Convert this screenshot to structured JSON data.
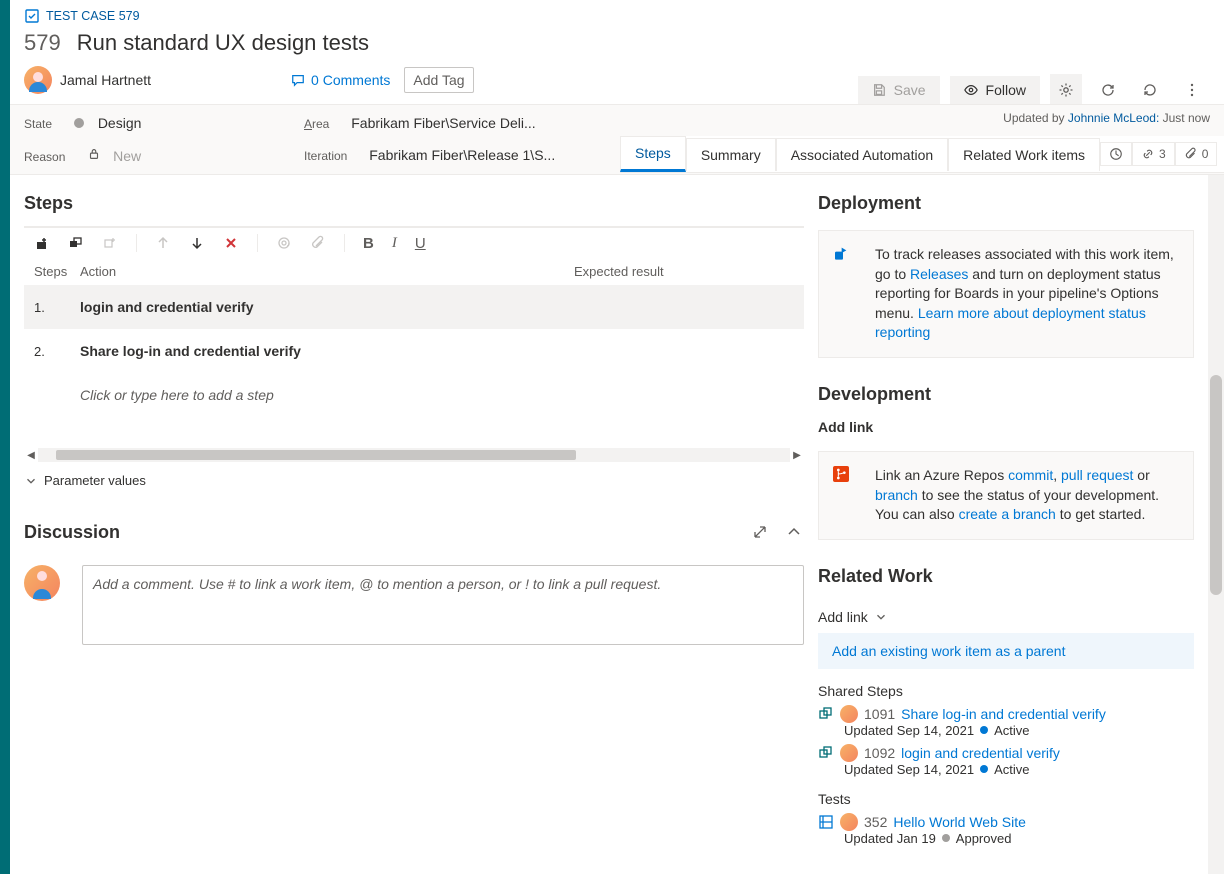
{
  "workItemType": "TEST CASE 579",
  "id": "579",
  "title": "Run standard UX design tests",
  "owner": "Jamal Hartnett",
  "comments": {
    "count": "0 Comments"
  },
  "addTag": "Add Tag",
  "actions": {
    "save": "Save",
    "follow": "Follow"
  },
  "updatedBy": {
    "prefix": "Updated by ",
    "name": "Johnnie McLeod:",
    "when": " Just now"
  },
  "fields": {
    "stateLabel": "State",
    "stateValue": "Design",
    "reasonLabel": "Reason",
    "reasonValue": "New",
    "areaLabel": "Area",
    "areaLabelChar": "A",
    "areaValue": "Fabrikam Fiber\\Service Deli...",
    "iterationLabel": "Iteration",
    "iterationValue": "Fabrikam Fiber\\Release 1\\S..."
  },
  "tabs": {
    "steps": "Steps",
    "summary": "Summary",
    "automation": "Associated Automation",
    "related": "Related Work items",
    "linksBadge": "3",
    "attachBadge": "0"
  },
  "stepsSection": {
    "title": "Steps",
    "cols": {
      "steps": "Steps",
      "action": "Action",
      "expected": "Expected result"
    },
    "rows": [
      {
        "num": "1.",
        "action": "login and credential verify",
        "expected": ""
      },
      {
        "num": "2.",
        "action": "Share log-in and credential verify",
        "expected": ""
      }
    ],
    "addPlaceholder": "Click or type here to add a step",
    "paramValues": "Parameter values"
  },
  "discussion": {
    "title": "Discussion",
    "placeholder": "Add a comment. Use # to link a work item, @ to mention a person, or ! to link a pull request."
  },
  "deployment": {
    "title": "Deployment",
    "text1": "To track releases associated with this work item, go to ",
    "link1": "Releases",
    "text2": " and turn on deployment status reporting for Boards in your pipeline's Options menu. ",
    "link2": "Learn more about deployment status reporting"
  },
  "development": {
    "title": "Development",
    "addLink": "Add link",
    "text1": "Link an Azure Repos ",
    "linkCommit": "commit",
    "comma": ", ",
    "linkPR": "pull request",
    "text2": " or ",
    "linkBranch": "branch",
    "text3": " to see the status of your development. You can also ",
    "linkCreate": "create a branch",
    "text4": " to get started."
  },
  "relatedWork": {
    "title": "Related Work",
    "addLink": "Add link",
    "parentLink": "Add an existing work item as a parent",
    "sharedSteps": "Shared Steps",
    "items": [
      {
        "id": "1091",
        "title": "Share log-in and credential verify",
        "updated": "Updated Sep 14, 2021",
        "status": "Active",
        "statusClass": "active",
        "iconType": "shared"
      },
      {
        "id": "1092",
        "title": "login and credential verify",
        "updated": "Updated Sep 14, 2021",
        "status": "Active",
        "statusClass": "active",
        "iconType": "shared"
      }
    ],
    "tests": "Tests",
    "testItems": [
      {
        "id": "352",
        "title": "Hello World Web Site",
        "updated": "Updated Jan 19",
        "status": "Approved",
        "statusClass": "approved",
        "iconType": "plan"
      }
    ]
  }
}
